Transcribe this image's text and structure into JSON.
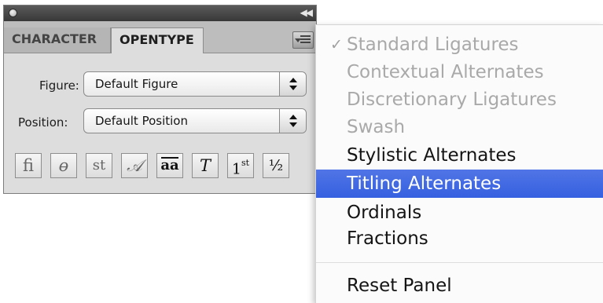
{
  "panel": {
    "tabs": [
      {
        "label": "CHARACTER"
      },
      {
        "label": "OPENTYPE"
      }
    ],
    "figure": {
      "label": "Figure:",
      "value": "Default Figure"
    },
    "position": {
      "label": "Position:",
      "value": "Default Position"
    },
    "glyph_buttons": [
      {
        "icon": "ligature-fi-icon",
        "glyph": "ﬁ"
      },
      {
        "icon": "discretionary-ligature-icon",
        "glyph": "ɵ"
      },
      {
        "icon": "st-ligature-icon",
        "glyph": "st"
      },
      {
        "icon": "swash-icon",
        "glyph": "𝒜"
      },
      {
        "icon": "stylistic-alternates-icon",
        "glyph": "aa"
      },
      {
        "icon": "titling-alternates-icon",
        "glyph": "T"
      },
      {
        "icon": "ordinals-icon",
        "glyph": "1",
        "sup": "st"
      },
      {
        "icon": "fractions-icon",
        "glyph": "½"
      }
    ]
  },
  "menu": {
    "items": [
      {
        "label": "Standard Ligatures",
        "state": "disabled",
        "checked": true,
        "check_mark": "✓"
      },
      {
        "label": "Contextual Alternates",
        "state": "disabled"
      },
      {
        "label": "Discretionary Ligatures",
        "state": "disabled"
      },
      {
        "label": "Swash",
        "state": "disabled"
      },
      {
        "label": "Stylistic Alternates",
        "state": "enabled"
      },
      {
        "label": "Titling Alternates",
        "state": "highlighted"
      },
      {
        "label": "Ordinals",
        "state": "enabled"
      },
      {
        "label": "Fractions",
        "state": "enabled"
      }
    ],
    "reset_label": "Reset Panel"
  },
  "colors": {
    "highlight": "#3c66e2",
    "disabled_text": "#a9a9a9",
    "panel_bg": "#dddddd",
    "titlebar": "#444444"
  }
}
